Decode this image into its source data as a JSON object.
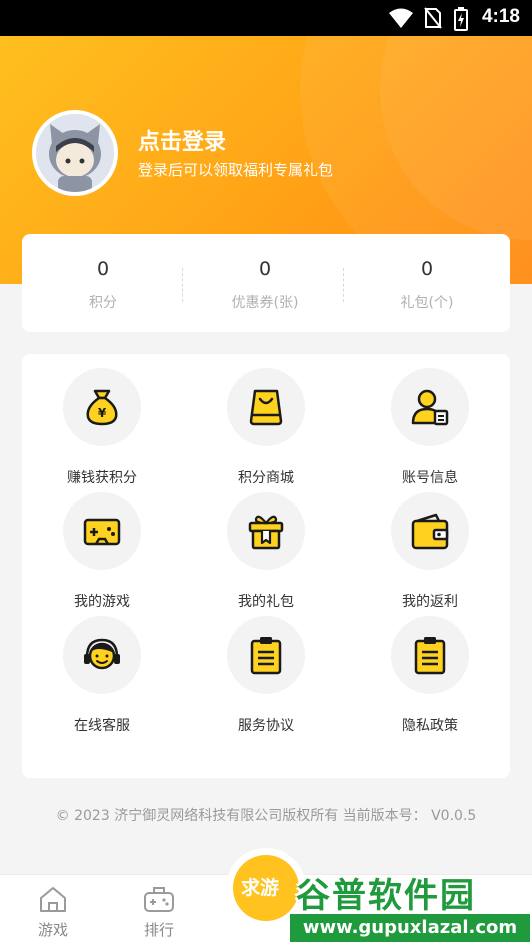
{
  "status_bar": {
    "time": "4:18",
    "icons": [
      "wifi-icon",
      "no-sim-icon",
      "battery-charging-icon"
    ]
  },
  "profile": {
    "title": "点击登录",
    "subtitle": "登录后可以领取福利专属礼包",
    "avatar_icon": "cat-hood-avatar-icon"
  },
  "stats": [
    {
      "value": "0",
      "label": "积分"
    },
    {
      "value": "0",
      "label": "优惠券(张)"
    },
    {
      "value": "0",
      "label": "礼包(个)"
    }
  ],
  "menu": [
    {
      "label": "赚钱获积分",
      "icon": "money-bag-icon"
    },
    {
      "label": "积分商城",
      "icon": "shopping-bag-icon"
    },
    {
      "label": "账号信息",
      "icon": "account-card-icon"
    },
    {
      "label": "我的游戏",
      "icon": "gamepad-icon"
    },
    {
      "label": "我的礼包",
      "icon": "gift-box-icon"
    },
    {
      "label": "我的返利",
      "icon": "wallet-icon"
    },
    {
      "label": "在线客服",
      "icon": "headset-icon"
    },
    {
      "label": "服务协议",
      "icon": "clipboard-icon"
    },
    {
      "label": "隐私政策",
      "icon": "clipboard-icon"
    }
  ],
  "copyright": "© 2023 济宁御灵网络科技有限公司版权所有 当前版本号： V0.0.5",
  "bottom_nav": [
    {
      "label": "游戏",
      "icon": "home-icon"
    },
    {
      "label": "排行",
      "icon": "controller-icon"
    }
  ],
  "center_button": {
    "label": "求游"
  },
  "watermark": {
    "main": "谷普软件园",
    "sub": "www.gupuxlazal.com"
  },
  "colors": {
    "accent": "#ffb01a",
    "accent_dark": "#ff8a12",
    "icon_fill": "#ffd21f",
    "icon_stroke": "#1a1a1a"
  }
}
